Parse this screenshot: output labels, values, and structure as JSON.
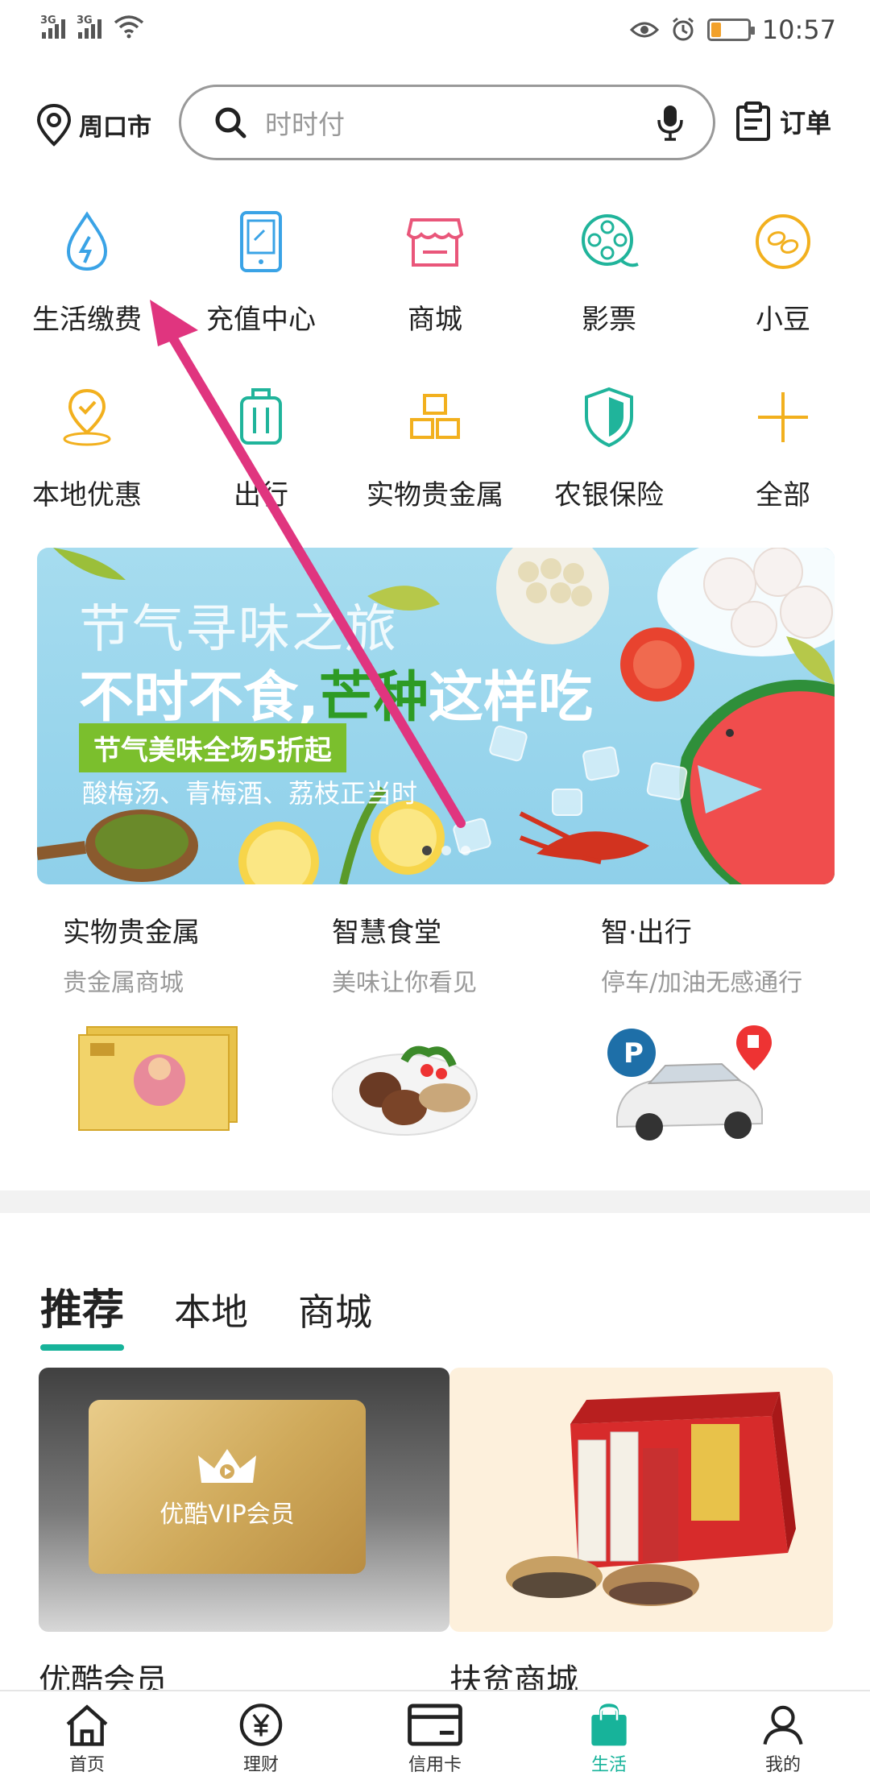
{
  "status_bar": {
    "network1": "3G",
    "network2": "3G",
    "time": "10:57",
    "battery_level": 0.2,
    "battery_color": "#f2a12b"
  },
  "header": {
    "location": "周口市",
    "search_placeholder": "时时付",
    "orders_label": "订单"
  },
  "services": [
    {
      "label": "生活缴费",
      "icon": "water-drop-icon"
    },
    {
      "label": "充值中心",
      "icon": "phone-icon"
    },
    {
      "label": "商城",
      "icon": "store-icon"
    },
    {
      "label": "影票",
      "icon": "film-reel-icon"
    },
    {
      "label": "小豆",
      "icon": "beans-icon"
    },
    {
      "label": "本地优惠",
      "icon": "location-check-icon"
    },
    {
      "label": "出行",
      "icon": "luggage-icon"
    },
    {
      "label": "实物贵金属",
      "icon": "gold-bars-icon"
    },
    {
      "label": "农银保险",
      "icon": "shield-icon"
    },
    {
      "label": "全部",
      "icon": "plus-icon"
    }
  ],
  "banner": {
    "title": "节气寻味之旅",
    "headline_a": "不时不食,",
    "headline_highlight": "芒种",
    "headline_b": "这样吃",
    "tag": "节气美味全场5折起",
    "subtitle": "酸梅汤、青梅酒、荔枝正当时"
  },
  "features": [
    {
      "title": "实物贵金属",
      "subtitle": "贵金属商城"
    },
    {
      "title": "智慧食堂",
      "subtitle": "美味让你看见"
    },
    {
      "title": "智·出行",
      "subtitle": "停车/加油无感通行"
    }
  ],
  "tabs": [
    {
      "label": "推荐",
      "active": true
    },
    {
      "label": "本地",
      "active": false
    },
    {
      "label": "商城",
      "active": false
    }
  ],
  "cards": [
    {
      "title": "优酷会员",
      "image_text": "优酷VIP会员"
    },
    {
      "title": "扶贫商城"
    }
  ],
  "bottom_nav": [
    {
      "label": "首页",
      "icon": "home-icon"
    },
    {
      "label": "理财",
      "icon": "yuan-icon"
    },
    {
      "label": "信用卡",
      "icon": "card-icon"
    },
    {
      "label": "生活",
      "icon": "shopping-bag-icon",
      "active": true
    },
    {
      "label": "我的",
      "icon": "user-icon"
    }
  ],
  "colors": {
    "accent": "#17b39a",
    "annotation_arrow": "#e0357f"
  }
}
